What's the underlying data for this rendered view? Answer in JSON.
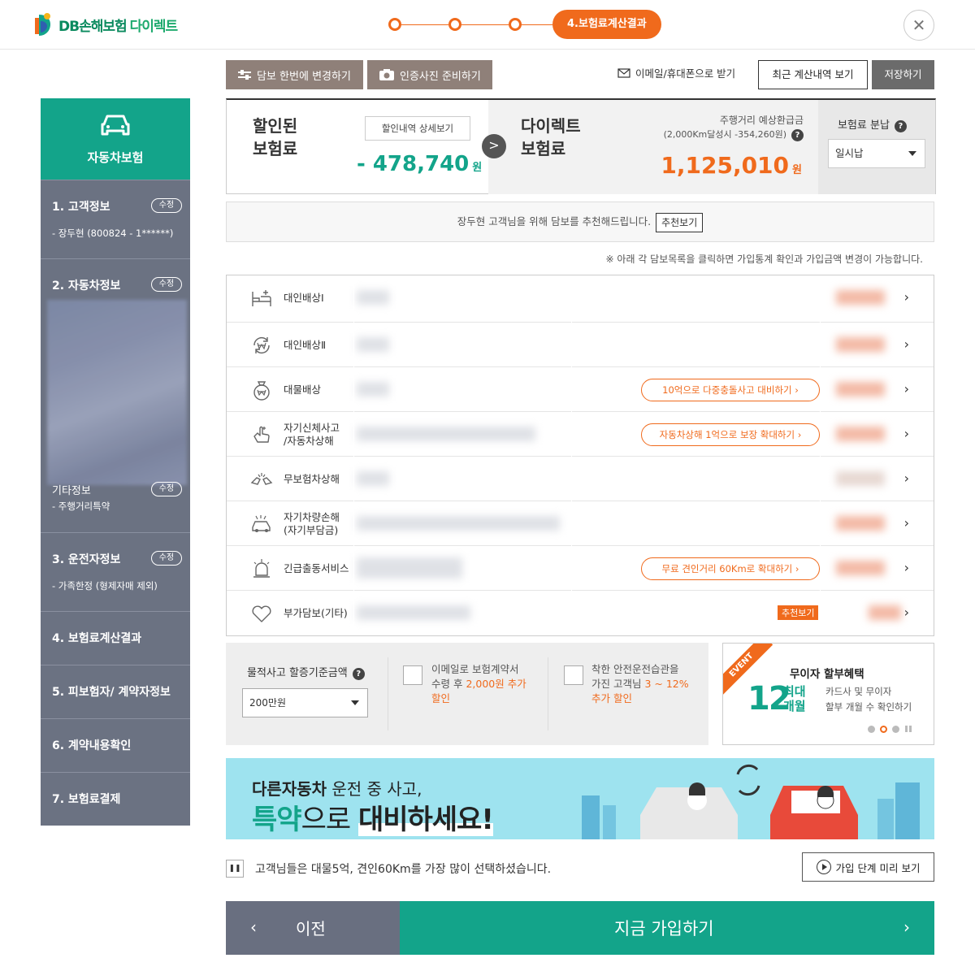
{
  "header": {
    "logo_text": "DB손해보험",
    "logo_direct": "다이렉트",
    "active_step": "4.보험료계산결과",
    "close_icon": "close-icon"
  },
  "sidebar": {
    "top_label": "자동차보험",
    "sections": [
      {
        "title": "1. 고객정보",
        "edit": "수정",
        "sub": "- 장두현 (800824 - 1******)"
      },
      {
        "title": "2. 자동차정보",
        "edit": "수정",
        "sub_title": "기타정보",
        "sub_edit": "수정",
        "sub": "- 주행거리특약"
      },
      {
        "title": "3. 운전자정보",
        "edit": "수정",
        "sub": "- 가족한정 (형제자매 제외)"
      },
      {
        "title": "4. 보험료계산결과"
      },
      {
        "title": "5. 피보험자/ 계약자정보"
      },
      {
        "title": "6. 계약내용확인"
      },
      {
        "title": "7. 보험료결제"
      }
    ]
  },
  "toolbar": {
    "change_coverage": "담보 한번에 변경하기",
    "prepare_photo": "인증사진 준비하기",
    "email_phone": "이메일/휴대폰으로 받기",
    "recent_calc": "최근 계산내역 보기",
    "save": "저장하기"
  },
  "premium": {
    "discounted_label_1": "할인된",
    "discounted_label_2": "보험료",
    "discount_detail_btn": "할인내역 상세보기",
    "discount_amount": "- 478,740",
    "won": "원",
    "direct_label_1": "다이렉트",
    "direct_label_2": "보험료",
    "mileage_label": "주행거리 예상환급금",
    "mileage_sub": "(2,000Km달성시 -354,260원)",
    "direct_amount": "1,125,010",
    "installment_label": "보험료 분납",
    "installment_value": "일시납"
  },
  "recommend": {
    "text": "장두현 고객님을 위해 담보를 추천해드립니다.",
    "button": "추천보기",
    "notice": "※ 아래 각 담보목록을 클릭하면 가입통계 확인과 가입금액 변경이 가능합니다."
  },
  "coverages": [
    {
      "name": "대인배상Ⅰ",
      "icon": "bed-icon"
    },
    {
      "name": "대인배상Ⅱ",
      "icon": "won-cycle-icon"
    },
    {
      "name": "대물배상",
      "icon": "money-bag-icon",
      "pill": "10억으로 다중충돌사고 대비하기 ›"
    },
    {
      "name_1": "자기신체사고",
      "name_2": "/자동차상해",
      "icon": "hand-icon",
      "pill": "자동차상해 1억으로 보장 확대하기 ›"
    },
    {
      "name": "무보험차상해",
      "icon": "crash-icon"
    },
    {
      "name_1": "자기차량손해",
      "name_2": "(자기부담금)",
      "icon": "car-damage-icon"
    },
    {
      "name": "긴급출동서비스",
      "icon": "siren-icon",
      "pill": "무료 견인거리 60Km로 확대하기 ›"
    },
    {
      "name": "부가담보(기타)",
      "icon": "heart-icon",
      "tag": "추천보기"
    }
  ],
  "options": {
    "property_label": "물적사고 할증기준금액",
    "property_value": "200만원",
    "email_1": "이메일로 보험계약서",
    "email_2a": "수령 후 ",
    "email_2b": "2,000원 추가",
    "email_3": "할인",
    "safe_1": "착한 안전운전습관을",
    "safe_2a": "가진 고객님 ",
    "safe_2b": "3 ~ 12%",
    "safe_3": "추가 할인"
  },
  "event": {
    "ribbon": "EVENT",
    "title": "무이자 할부혜택",
    "number": "12",
    "unit_1": "최대",
    "unit_2": "개월",
    "desc_1": "카드사 및 무이자",
    "desc_2": "할부 개월 수 확인하기"
  },
  "banner": {
    "line1_bold": "다른자동차",
    "line1_rest": " 운전 중 사고,",
    "line2_hl": "특약",
    "line2_thin": "으로 ",
    "line2_bold": "대비하세요!"
  },
  "footer": {
    "message": "고객님들은 대물5억, 견인60Km를 가장 많이 선택하셨습니다.",
    "preview": "가입 단계 미리 보기",
    "prev": "이전",
    "next": "지금 가입하기"
  },
  "colors": {
    "accent": "#13a48a",
    "orange": "#f06a1c",
    "sidebar": "#6b7282"
  }
}
